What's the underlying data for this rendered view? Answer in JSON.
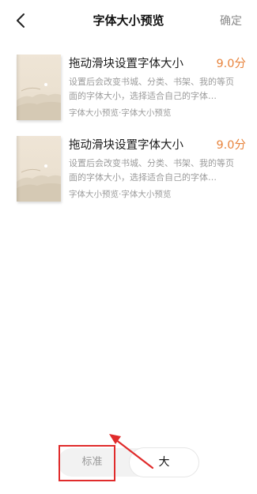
{
  "header": {
    "title": "字体大小预览",
    "confirm_label": "确定"
  },
  "books": [
    {
      "title": "拖动滑块设置字体大小",
      "score": "9.0分",
      "description": "设置后会改变书城、分类、书架、我的等页面的字体大小，选择适合自己的字体…",
      "meta": "字体大小预览·字体大小预览"
    },
    {
      "title": "拖动滑块设置字体大小",
      "score": "9.0分",
      "description": "设置后会改变书城、分类、书架、我的等页面的字体大小，选择适合自己的字体…",
      "meta": "字体大小预览·字体大小预览"
    }
  ],
  "font_size": {
    "options": [
      "标准",
      "大"
    ],
    "selected": "大"
  },
  "colors": {
    "accent": "#e8843d",
    "annotation": "#e02b2b"
  }
}
